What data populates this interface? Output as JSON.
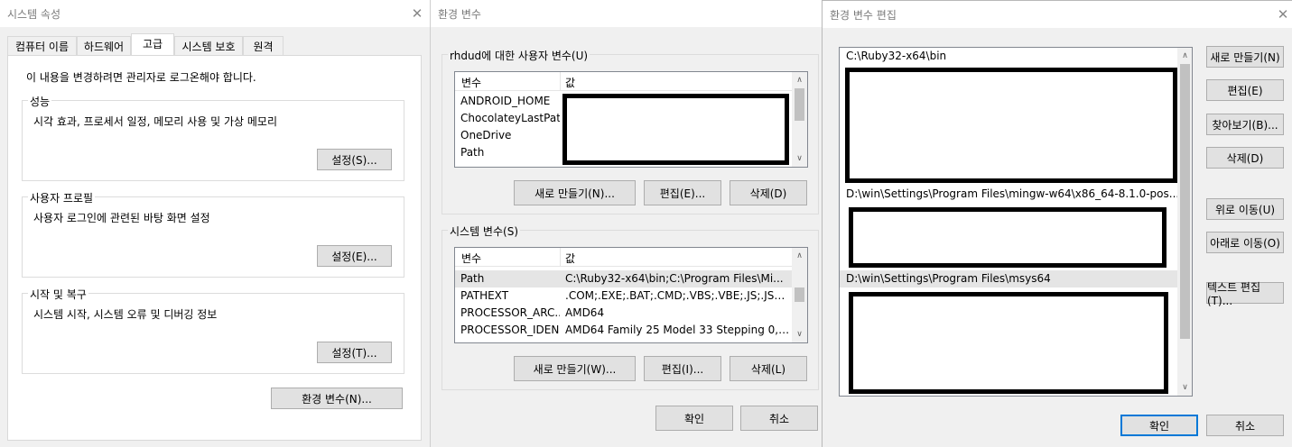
{
  "sysprops": {
    "title": "시스템 속성",
    "tabs": [
      "컴퓨터 이름",
      "하드웨어",
      "고급",
      "시스템 보호",
      "원격"
    ],
    "admin_note": "이 내용을 변경하려면 관리자로 로그온해야 합니다.",
    "performance": {
      "label": "성능",
      "desc": "시각 효과, 프로세서 일정, 메모리 사용 및 가상 메모리",
      "button": "설정(S)..."
    },
    "profile": {
      "label": "사용자 프로필",
      "desc": "사용자 로그인에 관련된 바탕 화면 설정",
      "button": "설정(E)..."
    },
    "startup": {
      "label": "시작 및 복구",
      "desc": "시스템 시작, 시스템 오류 및 디버깅 정보",
      "button": "설정(T)..."
    },
    "env_button": "환경 변수(N)..."
  },
  "envvars": {
    "title": "환경 변수",
    "user_group": "rhdud에 대한 사용자 변수(U)",
    "col_var": "변수",
    "col_val": "값",
    "user_vars": [
      {
        "name": "ANDROID_HOME",
        "value": ""
      },
      {
        "name": "ChocolateyLastPat...",
        "value": ""
      },
      {
        "name": "OneDrive",
        "value": ""
      },
      {
        "name": "Path",
        "value": ""
      }
    ],
    "user_buttons": {
      "new": "새로 만들기(N)...",
      "edit": "편집(E)...",
      "delete": "삭제(D)"
    },
    "sys_group": "시스템 변수(S)",
    "sys_vars": [
      {
        "name": "Path",
        "value": "C:\\Ruby32-x64\\bin;C:\\Program Files\\Mi..."
      },
      {
        "name": "PATHEXT",
        "value": ".COM;.EXE;.BAT;.CMD;.VBS;.VBE;.JS;.JSE;.W..."
      },
      {
        "name": "PROCESSOR_ARC...",
        "value": "AMD64"
      },
      {
        "name": "PROCESSOR_IDEN...",
        "value": "AMD64 Family 25 Model 33 Stepping 0, A..."
      }
    ],
    "sys_buttons": {
      "new": "새로 만들기(W)...",
      "edit": "편집(I)...",
      "delete": "삭제(L)"
    },
    "ok": "확인",
    "cancel": "취소"
  },
  "editenv": {
    "title": "환경 변수 편집",
    "entries": {
      "first": "C:\\Ruby32-x64\\bin",
      "mingw": "D:\\win\\Settings\\Program Files\\mingw-w64\\x86_64-8.1.0-pos...",
      "msys": "D:\\win\\Settings\\Program Files\\msys64"
    },
    "buttons": {
      "new": "새로 만들기(N)",
      "edit": "편집(E)",
      "browse": "찾아보기(B)...",
      "delete": "삭제(D)",
      "up": "위로 이동(U)",
      "down": "아래로 이동(O)",
      "text": "텍스트 편집(T)..."
    },
    "ok": "확인",
    "cancel": "취소"
  }
}
